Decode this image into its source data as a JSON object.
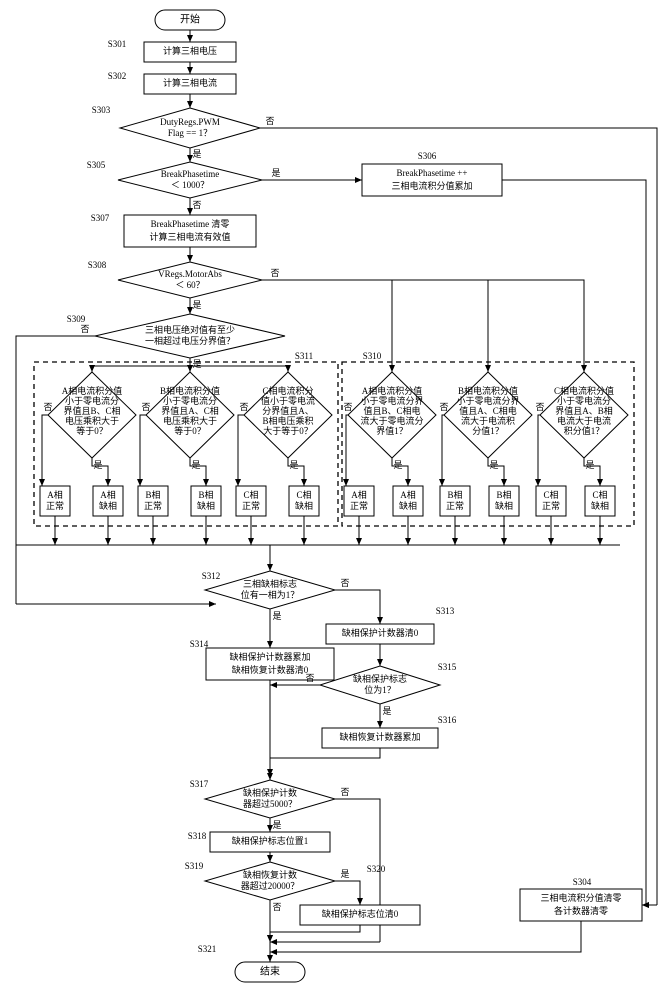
{
  "start": "开始",
  "end": "结束",
  "s": {
    "s301": "S301",
    "s302": "S302",
    "s303": "S303",
    "s304": "S304",
    "s305": "S305",
    "s306": "S306",
    "s307": "S307",
    "s308": "S308",
    "s309": "S309",
    "s310": "S310",
    "s311": "S311",
    "s312": "S312",
    "s313": "S313",
    "s314": "S314",
    "s315": "S315",
    "s316": "S316",
    "s317": "S317",
    "s318": "S318",
    "s319": "S319",
    "s320": "S320",
    "s321": "S321"
  },
  "b301": "计算三相电压",
  "b302": "计算三相电流",
  "d303a": "DutyRegs.PWM",
  "d303b": "Flag == 1？",
  "d305a": "BreakPhasetime",
  "d305b": "＜ 1000？",
  "b306a": "BreakPhasetime ++",
  "b306b": "三相电流积分值累加",
  "b307a": "BreakPhasetime 清零",
  "b307b": "计算三相电流有效值",
  "d308a": "VRegs.MotorAbs",
  "d308b": "＜ 60？",
  "d309a": "三相电压绝对值有至少",
  "d309b": "一相超过电压分界值？",
  "l311": {
    "da1": "A相电流积分值",
    "da2": "小于零电流分",
    "da3": "界值且B、C相",
    "da4": "电压乘积大于",
    "da5": "等于0？",
    "db1": "B相电流积分值",
    "db2": "小于零电流分",
    "db3": "界值且A、C相",
    "db4": "电压乘积大于",
    "db5": "等于0？",
    "dc1": "C相电流积分",
    "dc2": "值小于零电流",
    "dc3": "分界值且A、",
    "dc4": "B相电压乘积",
    "dc5": "大于等于0？"
  },
  "l310": {
    "da1": "A相电流积分值",
    "da2": "小于零电流分界",
    "da3": "值且B、C相电",
    "da4": "流大于零电流分",
    "da5": "界值1？",
    "db1": "B相电流积分值",
    "db2": "小于零电流分界",
    "db3": "值且A、C相电",
    "db4": "流大于电流积",
    "db5": "分值1？",
    "dc1": "C相电流积分值",
    "dc2": "小于零电流分",
    "dc3": "界值且A、B相",
    "dc4": "电流大于电流",
    "dc5": "积分值1？"
  },
  "r": {
    "aok1": "A相",
    "aok2": "正常",
    "abd1": "A相",
    "abd2": "缺相",
    "bok1": "B相",
    "bok2": "正常",
    "bbd1": "B相",
    "bbd2": "缺相",
    "cok1": "C相",
    "cok2": "正常",
    "cbd1": "C相",
    "cbd2": "缺相"
  },
  "d312a": "三相缺相标志",
  "d312b": "位有一相为1？",
  "b313": "缺相保护计数器清0",
  "b314a": "缺相保护计数器累加",
  "b314b": "缺相恢复计数器清0",
  "d315a": "缺相保护标志",
  "d315b": "位为1？",
  "b316": "缺相恢复计数器累加",
  "d317a": "缺相保护计数",
  "d317b": "器超过5000？",
  "b318": "缺相保护标志位置1",
  "d319a": "缺相恢复计数",
  "d319b": "器超过20000？",
  "b320": "缺相保护标志位清0",
  "b304a": "三相电流积分值清零",
  "b304b": "各计数器清零",
  "yes": "是",
  "no": "否",
  "chart_data": {
    "type": "flowchart",
    "nodes": [
      "S301",
      "S302",
      "S303",
      "S304",
      "S305",
      "S306",
      "S307",
      "S308",
      "S309",
      "S310",
      "S311",
      "S312",
      "S313",
      "S314",
      "S315",
      "S316",
      "S317",
      "S318",
      "S319",
      "S320",
      "S321"
    ]
  }
}
